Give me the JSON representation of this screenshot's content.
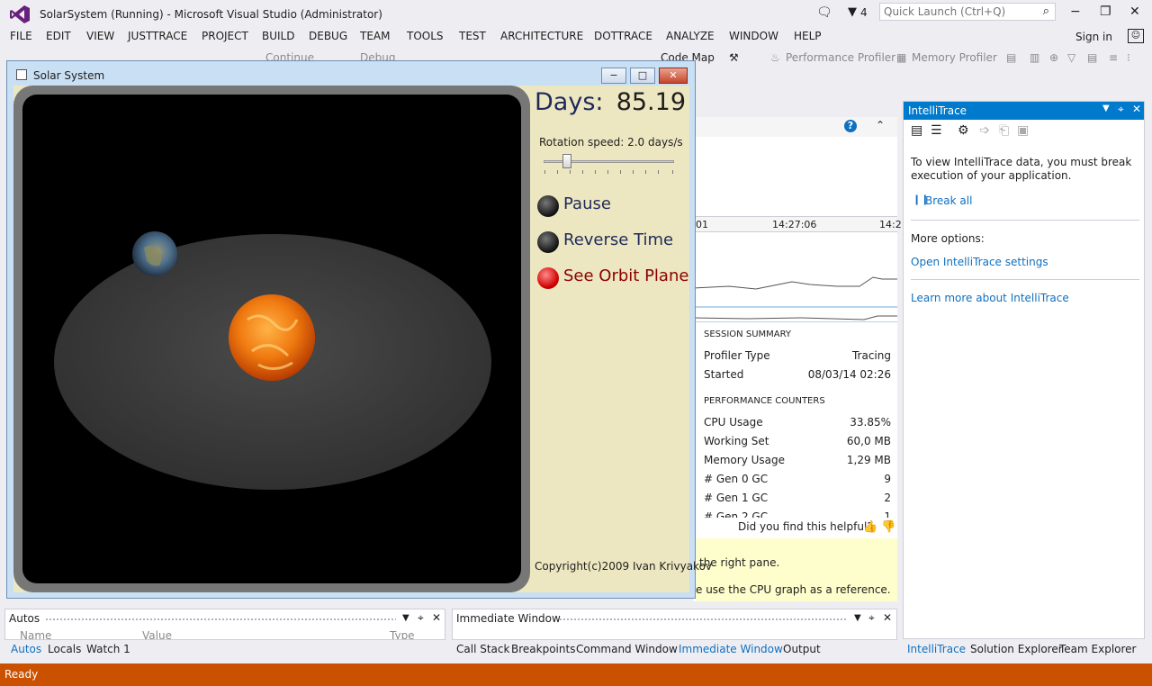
{
  "app": {
    "title": "SolarSystem (Running) - Microsoft Visual Studio (Administrator)",
    "notification_count": "4",
    "quick_launch_placeholder": "Quick Launch (Ctrl+Q)",
    "sign_in": "Sign in"
  },
  "menu": [
    "FILE",
    "EDIT",
    "VIEW",
    "JUSTTRACE",
    "PROJECT",
    "BUILD",
    "DEBUG",
    "TEAM",
    "TOOLS",
    "TEST",
    "ARCHITECTURE",
    "DOTTRACE",
    "ANALYZE",
    "WINDOW",
    "HELP"
  ],
  "toolbar": {
    "continue": "Continue",
    "config": "Debug",
    "code_map": "Code Map",
    "performance_profiler": "Performance Profiler",
    "memory_profiler": "Memory Profiler"
  },
  "solar_window": {
    "title": "Solar System",
    "days_label": "Days:",
    "days_value": "85.19",
    "rotation_speed": "Rotation speed: 2.0 days/s",
    "slider_position": 0.18,
    "options": [
      {
        "label": "Pause",
        "active": false
      },
      {
        "label": "Reverse Time",
        "active": false
      },
      {
        "label": "See Orbit Plane",
        "active": true
      }
    ],
    "copyright": "Copyright(c)2009 Ivan Krivyakov"
  },
  "diagnostics": {
    "timeline_labels": [
      "01",
      "14:27:06",
      "14:2"
    ],
    "session_summary_title": "SESSION SUMMARY",
    "session_summary": [
      {
        "key": "Profiler Type",
        "value": "Tracing"
      },
      {
        "key": "Started",
        "value": "08/03/14  02:26"
      }
    ],
    "perf_counters_title": "PERFORMANCE COUNTERS",
    "perf_counters": [
      {
        "key": "CPU Usage",
        "value": "33.85%"
      },
      {
        "key": "Working Set",
        "value": "60,0 MB"
      },
      {
        "key": "Memory Usage",
        "value": "1,29 MB"
      },
      {
        "key": "# Gen 0 GC",
        "value": "9"
      },
      {
        "key": "# Gen 1 GC",
        "value": "2"
      },
      {
        "key": "# Gen 2 GC",
        "value": "1"
      }
    ],
    "helpful": "Did you find this helpful?",
    "hint_line1": "the right pane.",
    "hint_line2": "e use the CPU graph as a reference."
  },
  "intellitrace": {
    "title": "IntelliTrace",
    "message": "To view IntelliTrace data, you must break execution of your application.",
    "break_all": "Break all",
    "more_options": "More options:",
    "open_settings": "Open IntelliTrace settings",
    "learn_more": "Learn more about IntelliTrace"
  },
  "bottom": {
    "autos_title": "Autos",
    "autos_columns": [
      "Name",
      "Value",
      "Type"
    ],
    "autos_tabs": [
      "Autos",
      "Locals",
      "Watch 1"
    ],
    "immediate_title": "Immediate Window",
    "immediate_tabs": [
      "Call Stack",
      "Breakpoints",
      "Command Window",
      "Immediate Window",
      "Output"
    ],
    "right_tabs": [
      "IntelliTrace",
      "Solution Explorer",
      "Team Explorer"
    ]
  },
  "status": "Ready",
  "colors": {
    "accent": "#007acc",
    "status_bar": "#ca5100",
    "link": "#0e70c0"
  }
}
